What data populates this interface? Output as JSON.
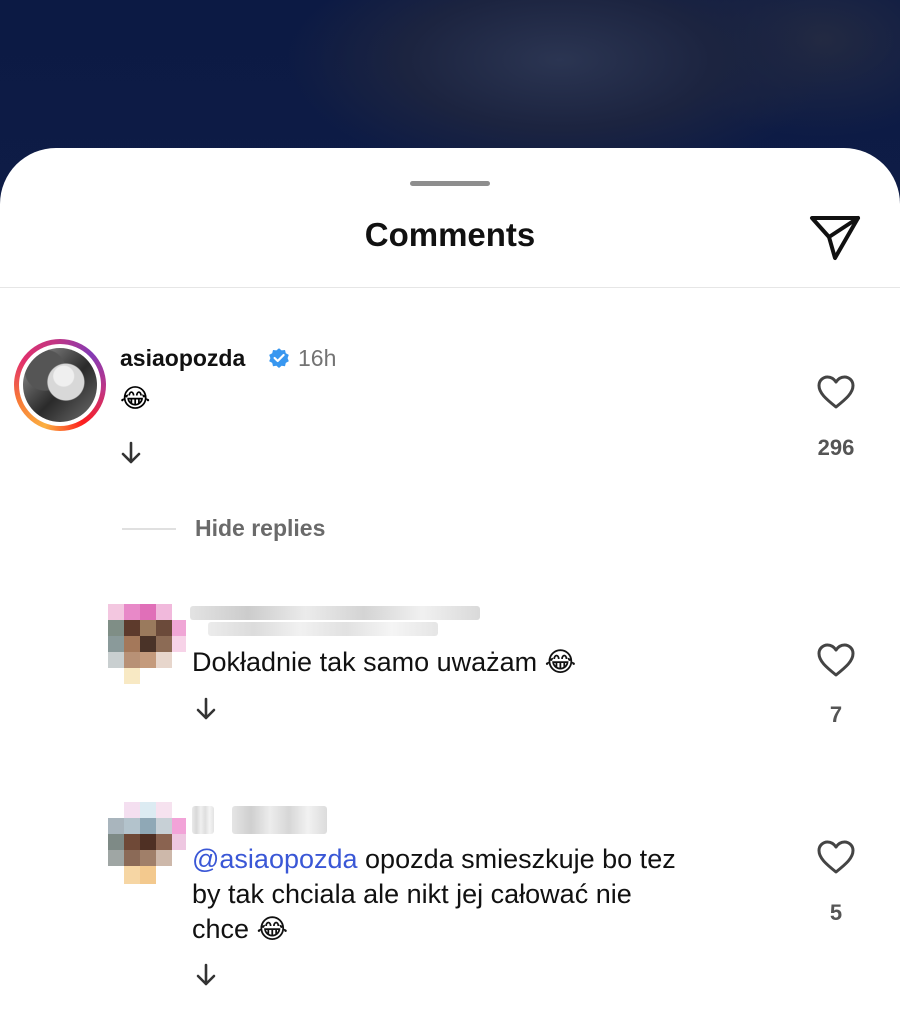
{
  "sheet": {
    "title": "Comments"
  },
  "icons": {
    "share": "paper-plane-icon",
    "like": "heart-outline-icon",
    "reply": "arrow-down-icon",
    "verified": "verified-badge-icon"
  },
  "colors": {
    "mention": "#3a57d6",
    "verified": "#3897f0",
    "muted": "#737373"
  },
  "comment_main": {
    "username": "asiaopozda",
    "time": "16h",
    "text": "😂",
    "likes": "296"
  },
  "thread": {
    "hide_replies": "Hide replies"
  },
  "replies": [
    {
      "text": "Dokładnie tak samo uważam 😂",
      "likes": "7"
    },
    {
      "mention": "@asiaopozda",
      "text_line1": " opozda smieszkuje bo tez",
      "text_line2": "by tak chciala ale nikt jej całować nie",
      "text_line3": "chce 😂",
      "likes": "5"
    }
  ]
}
